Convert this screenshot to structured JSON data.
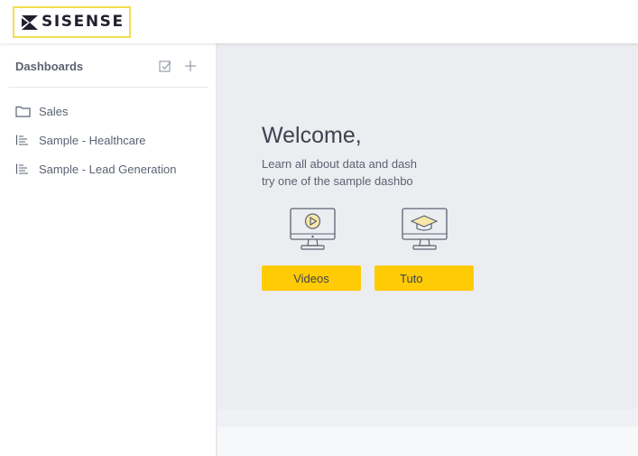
{
  "app": {
    "logo_text": "SISENSE",
    "brand_color": "#ffcb05",
    "logo_border_color": "#f2de4d"
  },
  "sidebar": {
    "title": "Dashboards",
    "header_icons": [
      "checkbox-icon",
      "plus-icon"
    ],
    "items": [
      {
        "label": "Sales",
        "icon": "folder-icon"
      },
      {
        "label": "Sample - Healthcare",
        "icon": "dashboard-list-icon"
      },
      {
        "label": "Sample - Lead Generation",
        "icon": "dashboard-list-icon"
      }
    ]
  },
  "main": {
    "welcome_title": "Welcome,",
    "intro_line_1": "Learn all about data and dash",
    "intro_line_2": "try one of the sample dashbo",
    "cards": [
      {
        "icon": "video-monitor-icon",
        "button_label": "Videos"
      },
      {
        "icon": "tutorial-monitor-icon",
        "button_label": "Tuto"
      }
    ]
  }
}
